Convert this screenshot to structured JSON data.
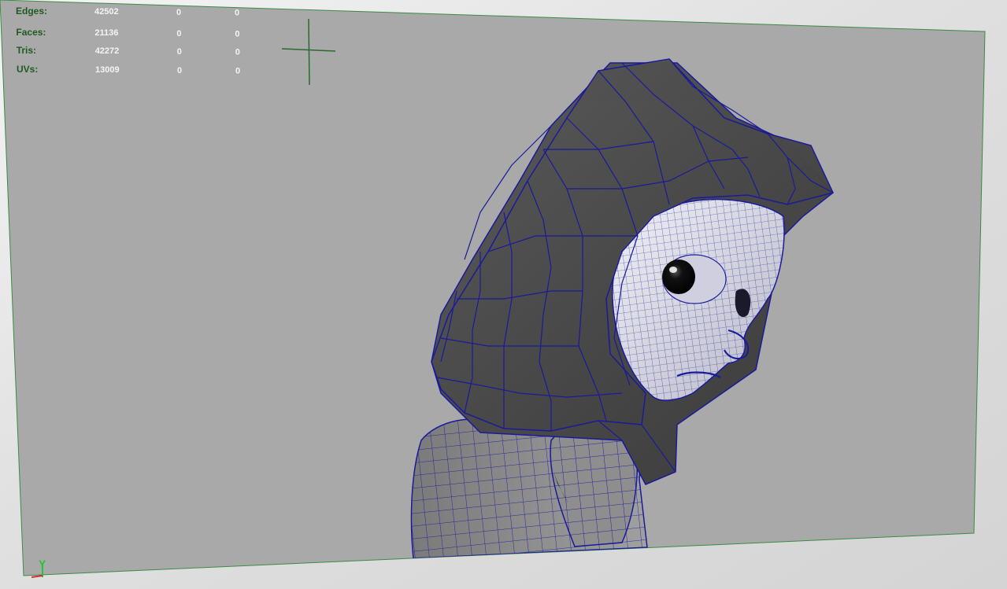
{
  "hud": {
    "rows": [
      {
        "label": "Edges:",
        "values": [
          "42502",
          "0",
          "0"
        ]
      },
      {
        "label": "Faces:",
        "values": [
          "21136",
          "0",
          "0"
        ]
      },
      {
        "label": "Tris:",
        "values": [
          "42272",
          "0",
          "0"
        ]
      },
      {
        "label": "UVs:",
        "values": [
          "13009",
          "0",
          "0"
        ]
      }
    ]
  },
  "axis_indicator": {
    "label": "Y"
  },
  "colors": {
    "viewport_bg": "#a9a9a9",
    "wireframe": "#1a1a9a",
    "hud_label": "#1f5a22",
    "hud_value": "#f4f4f4",
    "axis_y": "#27c33b"
  }
}
